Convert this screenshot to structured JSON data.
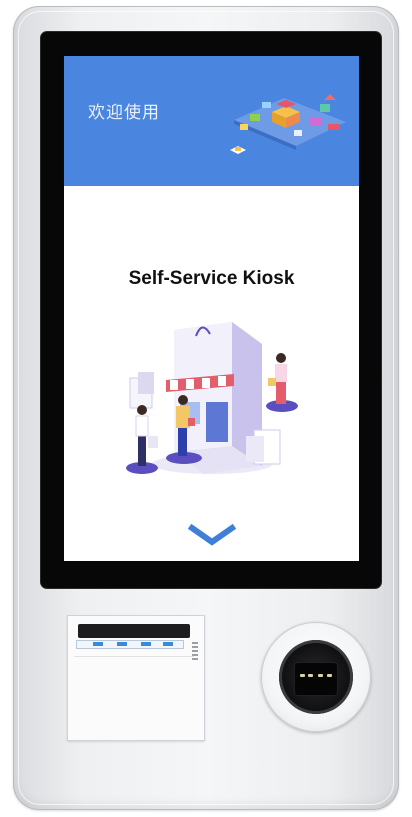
{
  "screen": {
    "welcome_text": "欢迎使用",
    "title": "Self-Service Kiosk"
  },
  "colors": {
    "banner": "#4a86e0",
    "chevron": "#3f7fd8",
    "bezel": "#070707"
  },
  "icons": {
    "banner": "isometric-store-map-icon",
    "illustration": "shopping-store-illustration-icon",
    "scroll": "chevron-down-icon",
    "printer": "receipt-printer-icon",
    "scanner": "barcode-scanner-icon"
  }
}
